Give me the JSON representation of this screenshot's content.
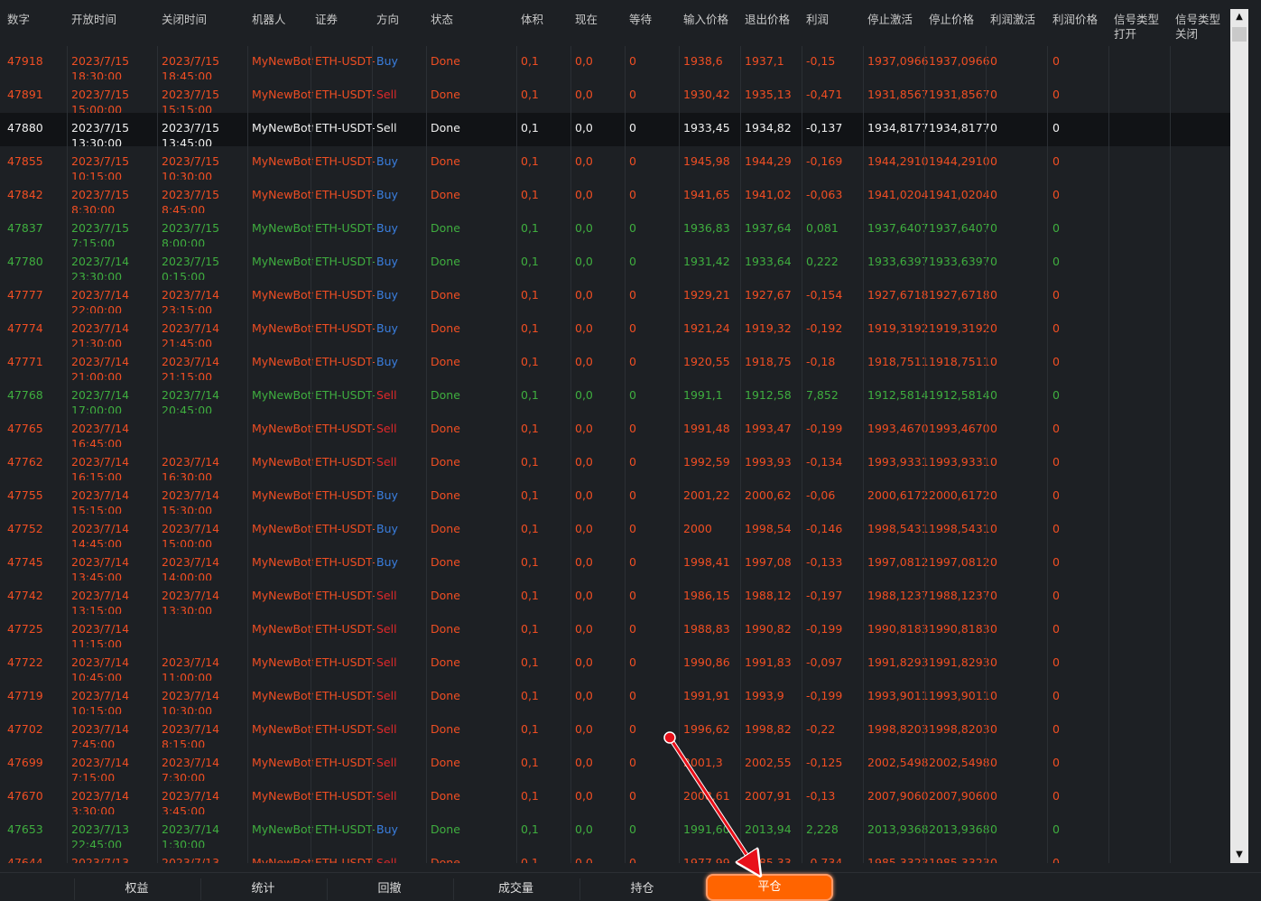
{
  "headers": [
    "数字",
    "开放时间",
    "关闭时间",
    "机器人",
    "证券",
    "方向",
    "状态",
    "体积",
    "现在",
    "等待",
    "输入价格",
    "退出价格",
    "利润",
    "停止激活",
    "停止价格",
    "利润激活",
    "利润价格",
    "信号类型\n打开",
    "信号类型\n关闭"
  ],
  "rows": [
    {
      "c": "red",
      "cells": [
        "47918",
        "2023/7/15\n18:30:00",
        "2023/7/15\n18:45:00",
        "MyNewBott",
        "ETH-USDT-",
        "Buy",
        "Done",
        "0,1",
        "0,0",
        "0",
        "1938,6",
        "1937,1",
        "-0,15",
        "1937,09667",
        "1937,09667",
        "0",
        "0"
      ],
      "dir": "blue"
    },
    {
      "c": "red",
      "cells": [
        "47891",
        "2023/7/15\n15:00:00",
        "2023/7/15\n15:15:00",
        "MyNewBott",
        "ETH-USDT-",
        "Sell",
        "Done",
        "0,1",
        "0,0",
        "0",
        "1930,42",
        "1935,13",
        "-0,471",
        "1931,85672",
        "1931,85672",
        "0",
        "0"
      ],
      "dir": "sellred"
    },
    {
      "c": "white",
      "sel": true,
      "cells": [
        "47880",
        "2023/7/15\n13:30:00",
        "2023/7/15\n13:45:00",
        "MyNewBott",
        "ETH-USDT-",
        "Sell",
        "Done",
        "0,1",
        "0,0",
        "0",
        "1933,45",
        "1934,82",
        "-0,137",
        "1934,81778",
        "1934,81778",
        "0",
        "0"
      ],
      "dir": "white"
    },
    {
      "c": "red",
      "cells": [
        "47855",
        "2023/7/15\n10:15:00",
        "2023/7/15\n10:30:00",
        "MyNewBott",
        "ETH-USDT-",
        "Buy",
        "Done",
        "0,1",
        "0,0",
        "0",
        "1945,98",
        "1944,29",
        "-0,169",
        "1944,29101",
        "1944,29101",
        "0",
        "0"
      ],
      "dir": "blue"
    },
    {
      "c": "red",
      "cells": [
        "47842",
        "2023/7/15\n8:30:00",
        "2023/7/15\n8:45:00",
        "MyNewBott",
        "ETH-USDT-",
        "Buy",
        "Done",
        "0,1",
        "0,0",
        "0",
        "1941,65",
        "1941,02",
        "-0,063",
        "1941,02049",
        "1941,02049",
        "0",
        "0"
      ],
      "dir": "blue"
    },
    {
      "c": "green",
      "cells": [
        "47837",
        "2023/7/15\n7:15:00",
        "2023/7/15\n8:00:00",
        "MyNewBott",
        "ETH-USDT-",
        "Buy",
        "Done",
        "0,1",
        "0,0",
        "0",
        "1936,83",
        "1937,64",
        "0,081",
        "1937,64075",
        "1937,64075",
        "0",
        "0"
      ],
      "dir": "blue"
    },
    {
      "c": "green",
      "cells": [
        "47780",
        "2023/7/14\n23:30:00",
        "2023/7/15\n0:15:00",
        "MyNewBott",
        "ETH-USDT-",
        "Buy",
        "Done",
        "0,1",
        "0,0",
        "0",
        "1931,42",
        "1933,64",
        "0,222",
        "1933,63978",
        "1933,63978",
        "0",
        "0"
      ],
      "dir": "blue"
    },
    {
      "c": "red",
      "cells": [
        "47777",
        "2023/7/14\n22:00:00",
        "2023/7/14\n23:15:00",
        "MyNewBott",
        "ETH-USDT-",
        "Buy",
        "Done",
        "0,1",
        "0,0",
        "0",
        "1929,21",
        "1927,67",
        "-0,154",
        "1927,67188",
        "1927,67188",
        "0",
        "0"
      ],
      "dir": "blue"
    },
    {
      "c": "red",
      "cells": [
        "47774",
        "2023/7/14\n21:30:00",
        "2023/7/14\n21:45:00",
        "MyNewBott",
        "ETH-USDT-",
        "Buy",
        "Done",
        "0,1",
        "0,0",
        "0",
        "1921,24",
        "1919,32",
        "-0,192",
        "1919,31923",
        "1919,31923",
        "0",
        "0"
      ],
      "dir": "blue"
    },
    {
      "c": "red",
      "cells": [
        "47771",
        "2023/7/14\n21:00:00",
        "2023/7/14\n21:15:00",
        "MyNewBott",
        "ETH-USDT-",
        "Buy",
        "Done",
        "0,1",
        "0,0",
        "0",
        "1920,55",
        "1918,75",
        "-0,18",
        "1918,75110",
        "1918,75110",
        "0",
        "0"
      ],
      "dir": "blue"
    },
    {
      "c": "green",
      "cells": [
        "47768",
        "2023/7/14\n17:00:00",
        "2023/7/14\n20:45:00",
        "MyNewBott",
        "ETH-USDT-",
        "Sell",
        "Done",
        "0,1",
        "0,0",
        "0",
        "1991,1",
        "1912,58",
        "7,852",
        "1912,58141",
        "1912,58141",
        "0",
        "0"
      ],
      "dir": "sellred"
    },
    {
      "c": "red",
      "cells": [
        "47765",
        "2023/7/14\n16:45:00",
        "",
        "MyNewBott",
        "ETH-USDT-",
        "Sell",
        "Done",
        "0,1",
        "0,0",
        "0",
        "1991,48",
        "1993,47",
        "-0,199",
        "1993,46707",
        "1993,46707",
        "0",
        "0"
      ],
      "dir": "sellred"
    },
    {
      "c": "red",
      "cells": [
        "47762",
        "2023/7/14\n16:15:00",
        "2023/7/14\n16:30:00",
        "MyNewBott",
        "ETH-USDT-",
        "Sell",
        "Done",
        "0,1",
        "0,0",
        "0",
        "1992,59",
        "1993,93",
        "-0,134",
        "1993,93314",
        "1993,93314",
        "0",
        "0"
      ],
      "dir": "sellred"
    },
    {
      "c": "red",
      "cells": [
        "47755",
        "2023/7/14\n15:15:00",
        "2023/7/14\n15:30:00",
        "MyNewBott",
        "ETH-USDT-",
        "Buy",
        "Done",
        "0,1",
        "0,0",
        "0",
        "2001,22",
        "2000,62",
        "-0,06",
        "2000,61727",
        "2000,61727",
        "0",
        "0"
      ],
      "dir": "blue"
    },
    {
      "c": "red",
      "cells": [
        "47752",
        "2023/7/14\n14:45:00",
        "2023/7/14\n15:00:00",
        "MyNewBott",
        "ETH-USDT-",
        "Buy",
        "Done",
        "0,1",
        "0,0",
        "0",
        "2000",
        "1998,54",
        "-0,146",
        "1998,54313",
        "1998,54313",
        "0",
        "0"
      ],
      "dir": "blue"
    },
    {
      "c": "red",
      "cells": [
        "47745",
        "2023/7/14\n13:45:00",
        "2023/7/14\n14:00:00",
        "MyNewBott",
        "ETH-USDT-",
        "Buy",
        "Done",
        "0,1",
        "0,0",
        "0",
        "1998,41",
        "1997,08",
        "-0,133",
        "1997,08121",
        "1997,08121",
        "0",
        "0"
      ],
      "dir": "blue"
    },
    {
      "c": "red",
      "cells": [
        "47742",
        "2023/7/14\n13:15:00",
        "2023/7/14\n13:30:00",
        "MyNewBott",
        "ETH-USDT-",
        "Sell",
        "Done",
        "0,1",
        "0,0",
        "0",
        "1986,15",
        "1988,12",
        "-0,197",
        "1988,12379",
        "1988,12379",
        "0",
        "0"
      ],
      "dir": "sellred"
    },
    {
      "c": "red",
      "cells": [
        "47725",
        "2023/7/14\n11:15:00",
        "",
        "MyNewBott",
        "ETH-USDT-",
        "Sell",
        "Done",
        "0,1",
        "0,0",
        "0",
        "1988,83",
        "1990,82",
        "-0,199",
        "1990,81838",
        "1990,81838",
        "0",
        "0"
      ],
      "dir": "sellred"
    },
    {
      "c": "red",
      "cells": [
        "47722",
        "2023/7/14\n10:45:00",
        "2023/7/14\n11:00:00",
        "MyNewBott",
        "ETH-USDT-",
        "Sell",
        "Done",
        "0,1",
        "0,0",
        "0",
        "1990,86",
        "1991,83",
        "-0,097",
        "1991,82935",
        "1991,82935",
        "0",
        "0"
      ],
      "dir": "sellred"
    },
    {
      "c": "red",
      "cells": [
        "47719",
        "2023/7/14\n10:15:00",
        "2023/7/14\n10:30:00",
        "MyNewBott",
        "ETH-USDT-",
        "Sell",
        "Done",
        "0,1",
        "0,0",
        "0",
        "1991,91",
        "1993,9",
        "-0,199",
        "1993,90119",
        "1993,90119",
        "0",
        "0"
      ],
      "dir": "sellred"
    },
    {
      "c": "red",
      "cells": [
        "47702",
        "2023/7/14\n7:45:00",
        "2023/7/14\n8:15:00",
        "MyNewBott",
        "ETH-USDT-",
        "Sell",
        "Done",
        "0,1",
        "0,0",
        "0",
        "1996,62",
        "1998,82",
        "-0,22",
        "1998,82032",
        "1998,82032",
        "0",
        "0"
      ],
      "dir": "sellred"
    },
    {
      "c": "red",
      "cells": [
        "47699",
        "2023/7/14\n7:15:00",
        "2023/7/14\n7:30:00",
        "MyNewBott",
        "ETH-USDT-",
        "Sell",
        "Done",
        "0,1",
        "0,0",
        "0",
        "2001,3",
        "2002,55",
        "-0,125",
        "2002,54983",
        "2002,54983",
        "0",
        "0"
      ],
      "dir": "sellred"
    },
    {
      "c": "red",
      "cells": [
        "47670",
        "2023/7/14\n3:30:00",
        "2023/7/14\n3:45:00",
        "MyNewBott",
        "ETH-USDT-",
        "Sell",
        "Done",
        "0,1",
        "0,0",
        "0",
        "2008,61",
        "2007,91",
        "-0,13",
        "2007,90609",
        "2007,90609",
        "0",
        "0"
      ],
      "dir": "sellred"
    },
    {
      "c": "green",
      "cells": [
        "47653",
        "2023/7/13\n22:45:00",
        "2023/7/14\n1:30:00",
        "MyNewBott",
        "ETH-USDT-",
        "Buy",
        "Done",
        "0,1",
        "0,0",
        "0",
        "1991,60",
        "2013,94",
        "2,228",
        "2013,93681",
        "2013,93681",
        "0",
        "0"
      ],
      "dir": "blue"
    },
    {
      "c": "red",
      "cells": [
        "47644",
        "2023/7/13\n",
        "2023/7/13\n",
        "MyNewBott",
        "ETH-USDT-",
        "Sell",
        "Done",
        "0,1",
        "0,0",
        "0",
        "1977,99",
        "1985,33",
        "-0,734",
        "1985,33239",
        "1985,33239",
        "0",
        "0"
      ],
      "dir": "sellred"
    }
  ],
  "tabs": [
    "权益",
    "统计",
    "回撤",
    "成交量",
    "持仓",
    "平仓"
  ],
  "active_tab": "平仓",
  "scroll": {
    "up": "▲",
    "down": "▼"
  },
  "colors": {
    "loss": "#f04e23",
    "profit": "#3fae3f",
    "buy": "#3a7fe0",
    "sell": "#e0282a",
    "accent": "#ff6400",
    "arrow": "#e8101a"
  }
}
